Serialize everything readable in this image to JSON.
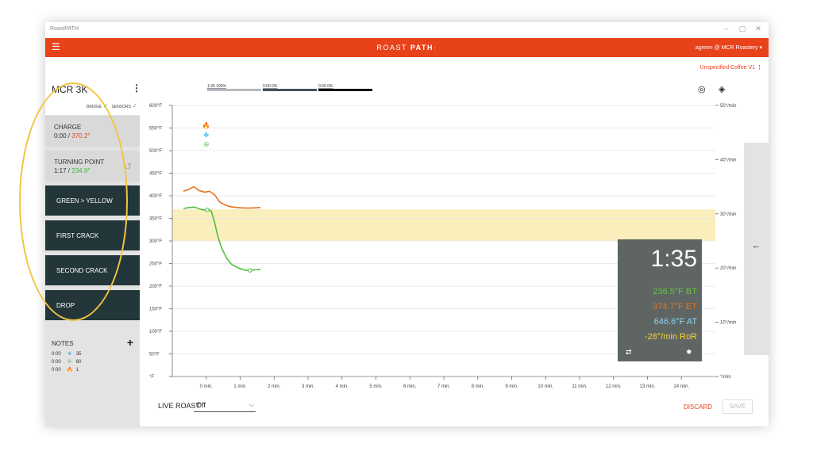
{
  "window": {
    "title": "RoastPATH",
    "controls": [
      "–",
      "▢",
      "✕"
    ]
  },
  "appbar": {
    "menu_icon": "☰",
    "brand_light": "ROAST",
    "brand_bold": "PATH",
    "brand_tm": "·",
    "user": "agreen @ MCR Roastery ▾"
  },
  "coffee": {
    "label": "Unspecified Coffee V1",
    "menu": "⋮"
  },
  "sidebar": {
    "machine": "MCR 3K",
    "kebab": "⋮",
    "bridge_label": "BRIDGE",
    "sensors_label": "SENSORS",
    "check": "✓",
    "charge": {
      "label": "CHARGE",
      "time": "0:00 / ",
      "temp": "370.2°"
    },
    "turning_point": {
      "label": "TURNING POINT",
      "time": "1:17 / ",
      "temp": "234.9°",
      "undo": "↺"
    },
    "events": [
      {
        "label": "GREEN > YELLOW"
      },
      {
        "label": "FIRST CRACK"
      },
      {
        "label": "SECOND CRACK"
      },
      {
        "label": "DROP"
      }
    ],
    "notes": {
      "header": "NOTES",
      "add": "+",
      "rows": [
        {
          "time": "0:00",
          "icon": "✤",
          "color": "#29b6e8",
          "value": "35"
        },
        {
          "time": "0:00",
          "icon": "✇",
          "color": "#3cb43c",
          "value": "80"
        },
        {
          "time": "0:00",
          "icon": "🔥",
          "color": "#e8421b",
          "value": "1"
        }
      ]
    }
  },
  "legend": [
    {
      "label": "1:35  100%",
      "color": "#b4b9bf"
    },
    {
      "label": "0:00  0%",
      "color": "#3f5457"
    },
    {
      "label": "0:00  0%",
      "color": "#111111"
    }
  ],
  "toolbar": {
    "target_icon": "◎",
    "layers_icon": "◈"
  },
  "chart_data": {
    "type": "line",
    "x_ticks": [
      "0 min.",
      "1 min.",
      "2 min.",
      "3 min.",
      "4 min.",
      "5 min.",
      "6 min.",
      "7 min.",
      "8 min.",
      "9 min.",
      "10 min.",
      "11 min.",
      "12 min.",
      "13 min.",
      "14 min."
    ],
    "xlim": [
      -1,
      15
    ],
    "y_ticks_left": [
      "600°F",
      "550°F",
      "500°F",
      "450°F",
      "400°F",
      "350°F",
      "300°F",
      "250°F",
      "200°F",
      "150°F",
      "100°F",
      "50°F",
      "°F"
    ],
    "ylim_left": [
      0,
      600
    ],
    "y_ticks_right": [
      "50°/min",
      "40°/min",
      "30°/min",
      "20°/min",
      "10°/min",
      "°/min"
    ],
    "ylim_right": [
      0,
      50
    ],
    "band": [
      300,
      370
    ],
    "band_color": "#fbeebd",
    "series": [
      {
        "color": "#e8731e",
        "x": [
          -0.67,
          -0.52,
          -0.37,
          -0.22,
          -0.05,
          0.1,
          0.25,
          0.4,
          0.55,
          0.7,
          0.9,
          1.1,
          1.35,
          1.6
        ],
        "y": [
          410,
          414,
          420,
          412,
          408,
          410,
          402,
          386,
          380,
          376,
          374,
          373,
          373,
          374
        ]
      },
      {
        "color": "#50c040",
        "x": [
          -0.67,
          -0.5,
          -0.35,
          -0.2,
          -0.05,
          0.05,
          0.15,
          0.25,
          0.35,
          0.45,
          0.6,
          0.75,
          0.95,
          1.17,
          1.4,
          1.6
        ],
        "y": [
          372,
          374,
          375,
          371,
          368,
          370,
          366,
          340,
          308,
          285,
          262,
          248,
          240,
          235,
          236,
          237
        ]
      }
    ],
    "markers": [
      {
        "x": 0.03,
        "y": 369,
        "color": "#50c040"
      },
      {
        "x": 1.29,
        "y": 235,
        "color": "#50c040"
      }
    ],
    "event_icons": [
      {
        "x": 0.0,
        "y": 556,
        "glyph": "🔥",
        "color": "#e8421b"
      },
      {
        "x": 0.0,
        "y": 535,
        "glyph": "✤",
        "color": "#29b6e8"
      },
      {
        "x": 0.0,
        "y": 514,
        "glyph": "✇",
        "color": "#3cb43c"
      }
    ]
  },
  "readout": {
    "time": "1:35",
    "bt": "236.5°F BT",
    "et": "374.7°F ET",
    "at": "646.6°F AT",
    "ror": "-28°/min RoR",
    "bt_color": "#62c941",
    "et_color": "#e8731e",
    "at_color": "#8dd3f0",
    "ror_color": "#f5d62e",
    "swap_icon": "⇄",
    "gear_icon": "✹"
  },
  "side_tab": {
    "arrow": "←"
  },
  "footer": {
    "live_roast_label": "LIVE ROAST",
    "live_roast_value": "Off",
    "chevron": "⌵",
    "discard": "DISCARD",
    "save": "SAVE"
  }
}
